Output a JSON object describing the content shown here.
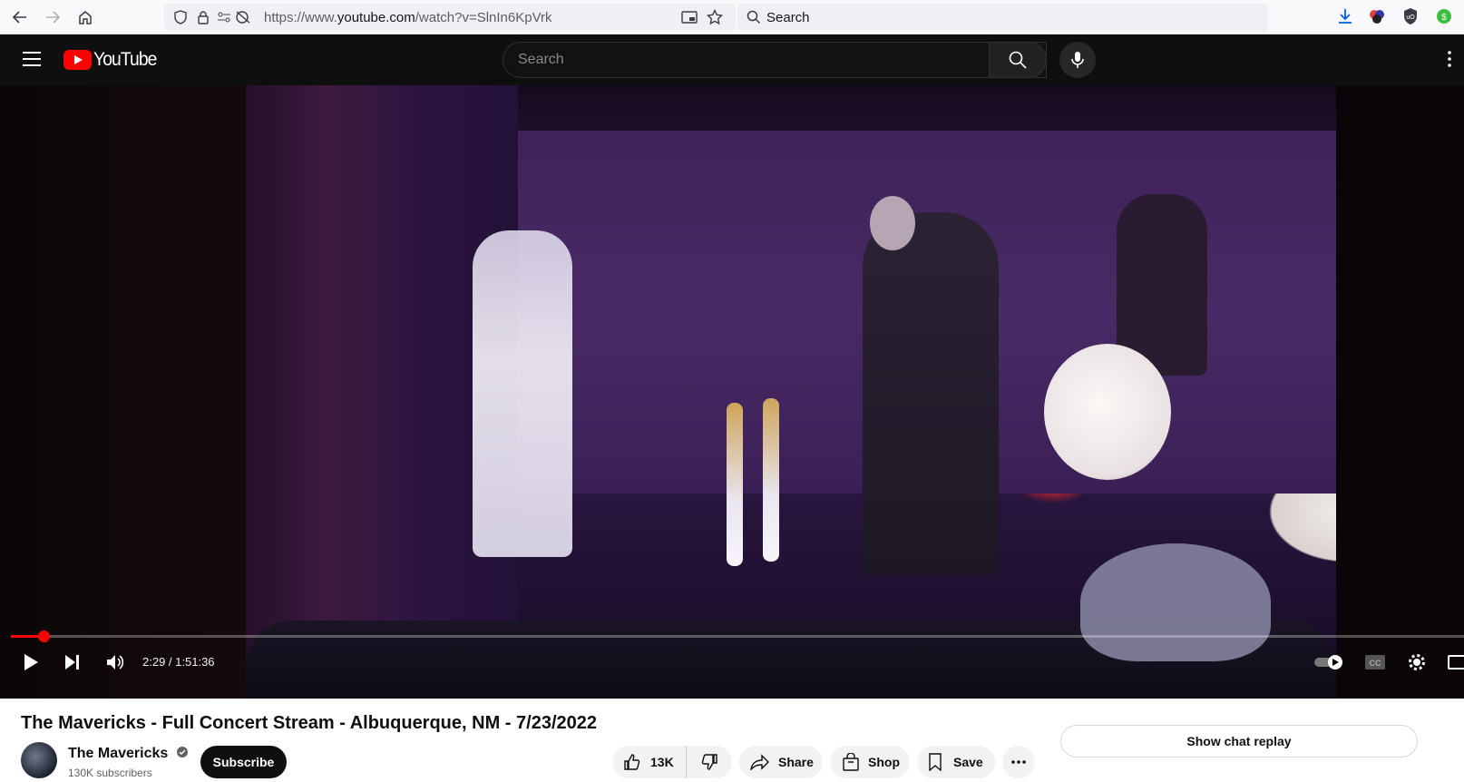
{
  "browser": {
    "url_prefix": "https://www.",
    "url_domain": "youtube.com",
    "url_path": "/watch?v=SlnIn6KpVrk",
    "search_placeholder": "Search"
  },
  "youtube": {
    "logo_text": "YouTube",
    "search_placeholder": "Search"
  },
  "player": {
    "current_time": "2:29",
    "duration": "1:51:36",
    "time_separator": " / ",
    "progress_fraction": 0.0223
  },
  "video": {
    "title": "The Mavericks - Full Concert Stream - Albuquerque, NM - 7/23/2022",
    "channel_name": "The Mavericks",
    "subscribers": "130K subscribers",
    "subscribe_label": "Subscribe",
    "like_count": "13K",
    "share_label": "Share",
    "shop_label": "Shop",
    "save_label": "Save",
    "chat_replay_label": "Show chat replay"
  },
  "colors": {
    "youtube_red": "#ff0000",
    "header_bg": "#0f0f0f"
  }
}
